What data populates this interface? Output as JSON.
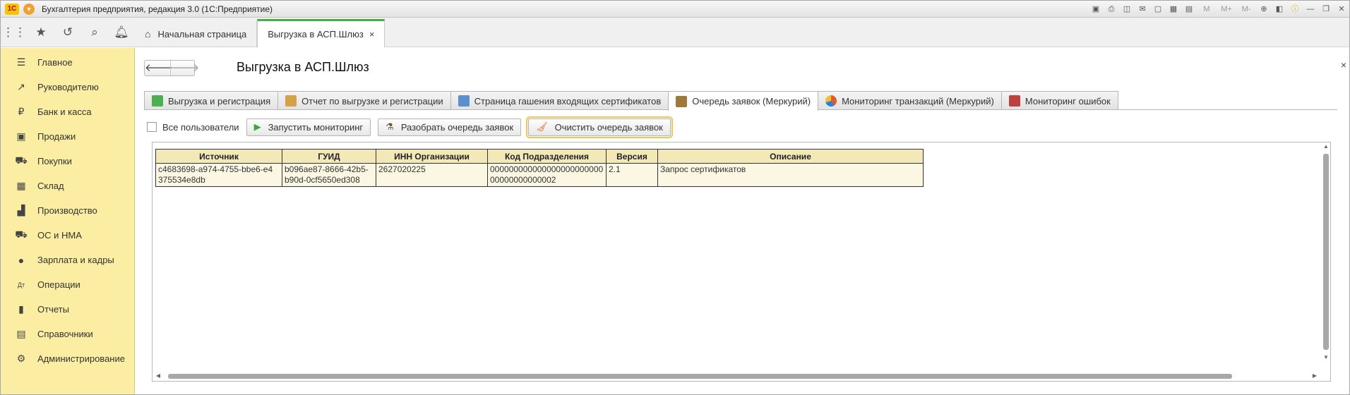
{
  "app": {
    "title": "Бухгалтерия предприятия, редакция 3.0  (1С:Предприятие)"
  },
  "titlebar_icons": [
    "save-icon",
    "print-icon",
    "preview-icon",
    "mail-icon",
    "calculator-icon",
    "calendar-icon"
  ],
  "memory_buttons": [
    "M",
    "M+",
    "M-"
  ],
  "page_tabs": {
    "home": "Начальная страница",
    "active": "Выгрузка в АСП.Шлюз",
    "close": "×"
  },
  "sidebar": {
    "items": [
      {
        "label": "Главное",
        "icon": "☰"
      },
      {
        "label": "Руководителю",
        "icon": "↗"
      },
      {
        "label": "Банк и касса",
        "icon": "₽"
      },
      {
        "label": "Продажи",
        "icon": "▣"
      },
      {
        "label": "Покупки",
        "icon": "⛟"
      },
      {
        "label": "Склад",
        "icon": "▦"
      },
      {
        "label": "Производство",
        "icon": "▟"
      },
      {
        "label": "ОС и НМА",
        "icon": "⛟"
      },
      {
        "label": "Зарплата и кадры",
        "icon": "●"
      },
      {
        "label": "Операции",
        "icon": "Дт"
      },
      {
        "label": "Отчеты",
        "icon": "▮"
      },
      {
        "label": "Справочники",
        "icon": "▤"
      },
      {
        "label": "Администрирование",
        "icon": "⚙"
      }
    ]
  },
  "form": {
    "title": "Выгрузка в АСП.Шлюз",
    "back": "🡐",
    "forward": "🡒",
    "close": "×",
    "tabs": [
      {
        "label": "Выгрузка и регистрация",
        "color": "#4caf50"
      },
      {
        "label": "Отчет по выгрузке и регистрации",
        "color": "#d4a24a"
      },
      {
        "label": "Страница гашения входящих сертификатов",
        "color": "#5a8fd0"
      },
      {
        "label": "Очередь заявок (Меркурий)",
        "color": "#a0783c"
      },
      {
        "label": "Мониторинг транзакций (Меркурий)",
        "color": "#e05a2a"
      },
      {
        "label": "Мониторинг ошибок",
        "color": "#c04040"
      }
    ],
    "active_tab_index": 3,
    "commands": {
      "all_users_label": "Все пользователи",
      "all_users_checked": false,
      "start_monitoring": "Запустить мониторинг",
      "parse_queue": "Разобрать очередь заявок",
      "clear_queue": "Очистить очередь заявок"
    },
    "table": {
      "columns": [
        "Источник",
        "ГУИД",
        "ИНН Организации",
        "Код Подразделения",
        "Версия",
        "Описание"
      ],
      "rows": [
        {
          "source": [
            "c4683698-a974-4755-bbe6-e4",
            "375534e8db"
          ],
          "guid": [
            "b096ae87-8666-42b5-",
            "b90d-0cf5650ed308"
          ],
          "inn": "2627020225",
          "code": [
            "000000000000000000000000",
            "00000000000002"
          ],
          "version": "2.1",
          "description": "Запрос сертификатов"
        }
      ]
    }
  }
}
